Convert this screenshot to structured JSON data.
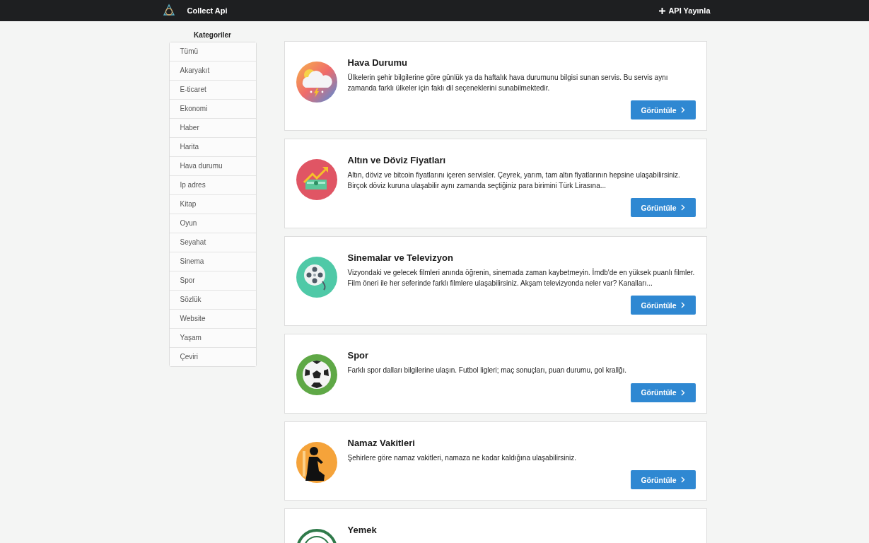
{
  "navbar": {
    "title": "Collect Api",
    "action": "API Yayınla"
  },
  "sidebar": {
    "heading": "Kategoriler",
    "items": [
      {
        "label": "Tümü"
      },
      {
        "label": "Akaryakıt"
      },
      {
        "label": "E-ticaret"
      },
      {
        "label": "Ekonomi"
      },
      {
        "label": "Haber"
      },
      {
        "label": "Harita"
      },
      {
        "label": "Hava durumu"
      },
      {
        "label": "Ip adres"
      },
      {
        "label": "Kitap"
      },
      {
        "label": "Oyun"
      },
      {
        "label": "Seyahat"
      },
      {
        "label": "Sinema"
      },
      {
        "label": "Spor"
      },
      {
        "label": "Sözlük"
      },
      {
        "label": "Website"
      },
      {
        "label": "Yaşam"
      },
      {
        "label": "Çeviri"
      }
    ]
  },
  "cards": [
    {
      "kind": "weather",
      "title": "Hava Durumu",
      "description": "Ülkelerin şehir bilgilerine göre günlük ya da haftalık hava durumunu bilgisi sunan servis. Bu servis aynı zamanda farklı ülkeler için faklı dil seçeneklerini sunabilmektedir.",
      "button": "Görüntüle"
    },
    {
      "kind": "money",
      "title": "Altın ve Döviz Fiyatları",
      "description": "Altın, döviz ve bitcoin fiyatlarını içeren servisler. Çeyrek, yarım, tam altın fiyatlarının hepsine ulaşabilirsiniz. Birçok döviz kuruna ulaşabilir aynı zamanda seçtiğiniz para birimini Türk Lirasına...",
      "button": "Görüntüle"
    },
    {
      "kind": "film",
      "title": "Sinemalar ve Televizyon",
      "description": "Vizyondaki ve gelecek filmleri anında öğrenin, sinemada zaman kaybetmeyin. İmdb'de en yüksek puanlı filmler. Film öneri ile her seferinde farklı filmlere ulaşabilirsiniz. Akşam televizyonda neler var? Kanalları...",
      "button": "Görüntüle"
    },
    {
      "kind": "ball",
      "title": "Spor",
      "description": "Farklı spor dalları bilgilerine ulaşın. Futbol ligleri; maç sonuçları, puan durumu, gol krallğı.",
      "button": "Görüntüle"
    },
    {
      "kind": "prayer",
      "title": "Namaz Vakitleri",
      "description": "Şehirlere göre namaz vakitleri, namaza ne kadar kaldığına ulaşabilirsiniz.",
      "button": "Görüntüle"
    },
    {
      "kind": "food",
      "title": "Yemek"
    }
  ]
}
